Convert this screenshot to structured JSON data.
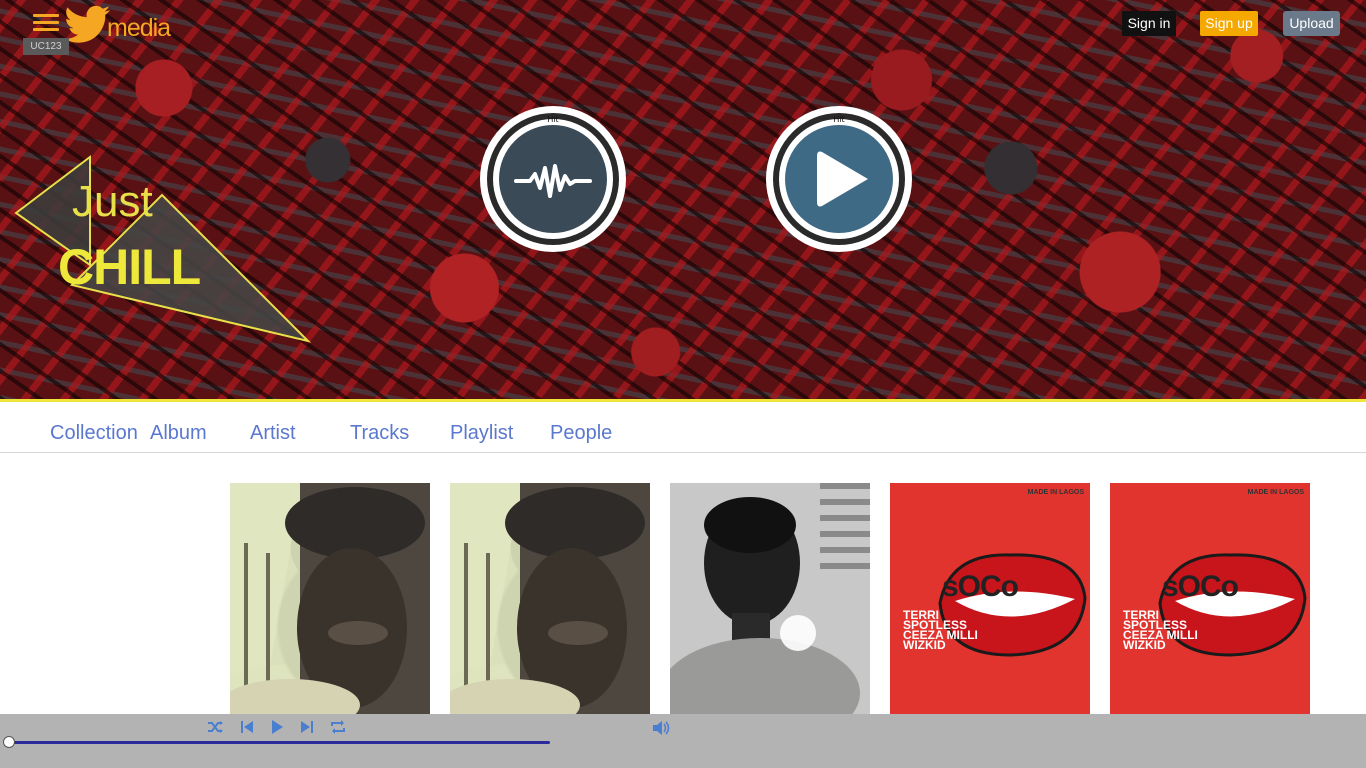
{
  "header": {
    "logo_text": "media",
    "user_badge": "UC123",
    "signin_label": "Sign in",
    "signup_label": "Sign up",
    "upload_label": "Upload"
  },
  "hero": {
    "badge_line1": "Just",
    "badge_line2": "CHILL",
    "circle_ring_text": "Hit to upload your audio content",
    "circle_ring_text_2": "Hit to upload your video content"
  },
  "nav": {
    "items": [
      {
        "label": "Collection"
      },
      {
        "label": "Album"
      },
      {
        "label": "Artist"
      },
      {
        "label": "Tracks"
      },
      {
        "label": "Playlist"
      },
      {
        "label": "People"
      }
    ]
  },
  "cards": [
    {
      "image": "portrait-cap-1"
    },
    {
      "image": "portrait-cap-2"
    },
    {
      "image": "portrait-bw"
    },
    {
      "image": "soco-cover",
      "title": "sOCo",
      "artists": [
        "TERRI",
        "SPOTLESS",
        "CEEZA MILLI",
        "WIZKID"
      ],
      "tag": "MADE IN LAGOS"
    },
    {
      "image": "soco-cover",
      "title": "sOCo",
      "artists": [
        "TERRI",
        "SPOTLESS",
        "CEEZA MILLI",
        "WIZKID"
      ],
      "tag": "MADE IN LAGOS"
    }
  ],
  "player": {
    "controls": [
      "shuffle-icon",
      "previous-icon",
      "play-icon",
      "next-icon",
      "repeat-icon"
    ],
    "progress": 0.0,
    "volume_icon": "volume-icon"
  },
  "colors": {
    "brand_orange": "#f5a623",
    "nav_blue": "#5a78d0",
    "accent_yellow": "#f0e53a",
    "player_bg": "#b3b3b3",
    "circle_blue": "#3f6a86"
  }
}
